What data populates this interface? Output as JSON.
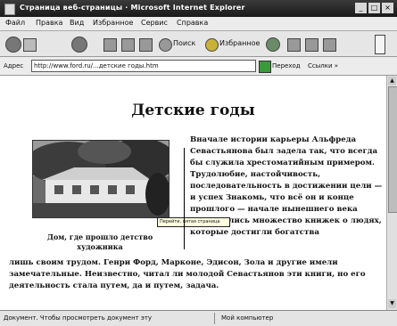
{
  "window": {
    "title": "Страница веб-страницы · Microsoft Internet Explorer"
  },
  "menubar": {
    "items": [
      "Файл",
      "Правка",
      "Вид",
      "Избранное",
      "Сервис",
      "Справка"
    ]
  },
  "toolbar": {
    "search_label": "Поиск",
    "favorites_label": "Избранное"
  },
  "addressbar": {
    "label": "Адрес",
    "value": "http://www.ford.ru/...детские годы.htm",
    "go_label": "Переход",
    "links_label": "Ссылки »"
  },
  "page": {
    "title": "Детские годы",
    "caption": "Дом, где прошло детство художника",
    "right_text": "Вначале истории карьеры Альфреда Севастьянова был задела так, что всегда бы служила хрестоматийным примером. Трудолюбие, настойчивость, последовательность в достижении цели — и успех Знакомь, что всё он и конце прошлого — начале нынешнего века выпускались множество книжек о людях, которые достигли богатства",
    "bottom_text": "лишь своим трудом. Генри Форд, Марконе, Эдисон, Зола и другие имели замечательные. Неизвестно, читал ли молодой Севастьянов эти книги, но его деятельность стала путем, да и путем, задача.",
    "tooltip": "Перейти, пятая страница"
  },
  "statusbar": {
    "left": "Документ. Чтобы просмотреть документ эту",
    "right": "Мой компьютер"
  }
}
